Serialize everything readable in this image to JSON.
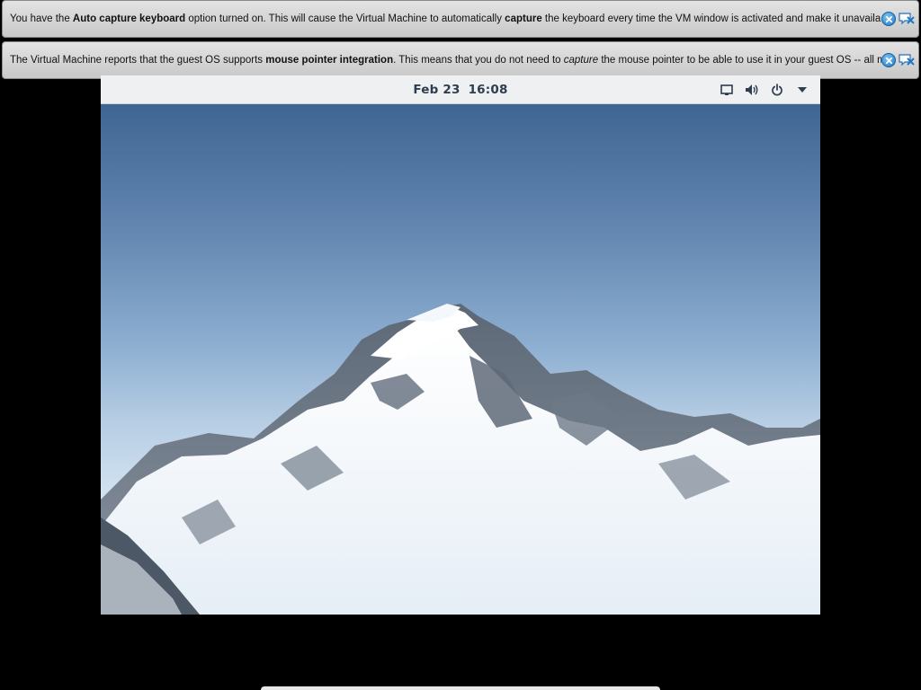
{
  "notifications": [
    {
      "segments": [
        {
          "text": "You have the ",
          "style": "normal"
        },
        {
          "text": "Auto capture keyboard",
          "style": "bold"
        },
        {
          "text": " option turned on. This will cause the Virtual Machine to automatically ",
          "style": "normal"
        },
        {
          "text": "capture",
          "style": "bold"
        },
        {
          "text": " the keyboard every time the VM window is activated and make it unavailable to",
          "style": "normal"
        }
      ],
      "close_icon": "close-icon",
      "dont_show_icon": "do-not-show-again-icon"
    },
    {
      "segments": [
        {
          "text": "The Virtual Machine reports that the guest OS supports ",
          "style": "normal"
        },
        {
          "text": "mouse pointer integration",
          "style": "bold"
        },
        {
          "text": ". This means that you do not need to ",
          "style": "normal"
        },
        {
          "text": "capture",
          "style": "italic"
        },
        {
          "text": " the mouse pointer to be able to use it in your guest OS -- all mouse",
          "style": "normal"
        }
      ],
      "close_icon": "close-icon",
      "dont_show_icon": "do-not-show-again-icon"
    }
  ],
  "guest": {
    "topbar": {
      "date": "Feb 23",
      "time": "16:08",
      "tray_icons": [
        "display-icon",
        "volume-icon",
        "power-icon",
        "dropdown-arrow-icon"
      ]
    },
    "wallpaper": "snow-capped-mountain"
  },
  "colors": {
    "notification_bg": "#d6d6d6",
    "topbar_bg": "#eef0f2",
    "clock_text": "#2e3d4f",
    "sky_top": "#3f6592",
    "sky_bottom": "#dde9f3"
  }
}
